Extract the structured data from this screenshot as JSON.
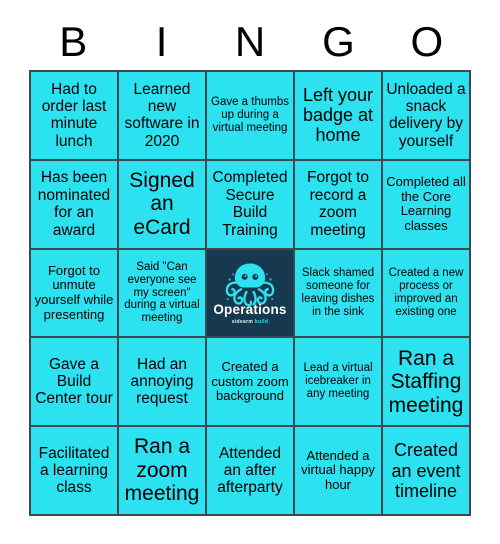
{
  "card": {
    "header_letters": [
      "B",
      "I",
      "N",
      "G",
      "O"
    ],
    "colors": {
      "cell_background": "#2ce2f0",
      "grid_line": "#3a4a4f",
      "text": "#000000",
      "free_space_background": "#17394f",
      "logo_accent": "#2ce2f0",
      "page_background": "#ffffff"
    },
    "rows": [
      [
        {
          "text": "Had to order last minute lunch",
          "size": "md"
        },
        {
          "text": "Learned new software in 2020",
          "size": "md"
        },
        {
          "text": "Gave a thumbs up during a virtual meeting",
          "size": "xs"
        },
        {
          "text": "Left your badge at home",
          "size": "lg"
        },
        {
          "text": "Unloaded a snack delivery by yourself",
          "size": "md"
        }
      ],
      [
        {
          "text": "Has been nominated for an award",
          "size": "md"
        },
        {
          "text": "Signed an eCard",
          "size": "xl"
        },
        {
          "text": "Completed Secure Build Training",
          "size": "md"
        },
        {
          "text": "Forgot to record a zoom meeting",
          "size": "md"
        },
        {
          "text": "Completed all the Core Learning classes",
          "size": "sm"
        }
      ],
      [
        {
          "text": "Forgot to unmute yourself while presenting",
          "size": "sm"
        },
        {
          "text": "Said \"Can everyone see my screen\" during a virtual meeting",
          "size": "xs"
        },
        {
          "text": "",
          "size": "md",
          "free_space": true
        },
        {
          "text": "Slack shamed someone for leaving dishes in the sink",
          "size": "xs"
        },
        {
          "text": "Created a new process or improved an existing one",
          "size": "xs"
        }
      ],
      [
        {
          "text": "Gave a Build Center tour",
          "size": "md"
        },
        {
          "text": "Had an annoying request",
          "size": "md"
        },
        {
          "text": "Created a custom zoom background",
          "size": "sm"
        },
        {
          "text": "Lead a virtual icebreaker in any meeting",
          "size": "xs"
        },
        {
          "text": "Ran a Staffing meeting",
          "size": "xl"
        }
      ],
      [
        {
          "text": "Facilitated a learning class",
          "size": "md"
        },
        {
          "text": "Ran a zoom meeting",
          "size": "xl"
        },
        {
          "text": "Attended an after afterparty",
          "size": "md"
        },
        {
          "text": "Attended a virtual happy hour",
          "size": "sm"
        },
        {
          "text": "Created an event timeline",
          "size": "lg"
        }
      ]
    ],
    "free_space": {
      "wordmark": "Operations",
      "tagline_part_one": "sidearm",
      "tagline_part_two": "build",
      "icon": "octopus-icon"
    }
  }
}
